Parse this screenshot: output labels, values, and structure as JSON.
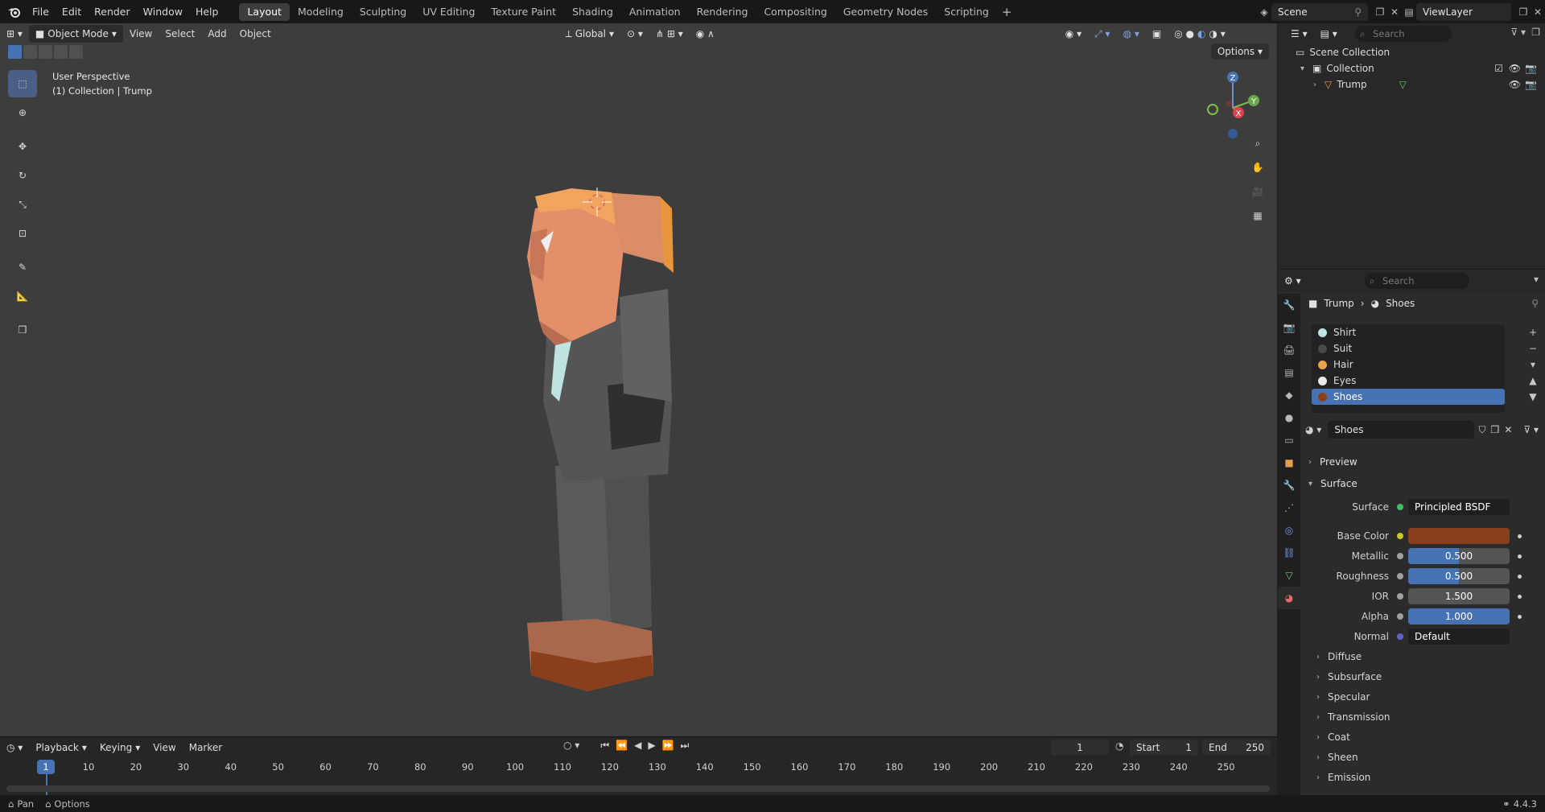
{
  "topbar": {
    "menus": [
      "File",
      "Edit",
      "Render",
      "Window",
      "Help"
    ],
    "workspaces": [
      "Layout",
      "Modeling",
      "Sculpting",
      "UV Editing",
      "Texture Paint",
      "Shading",
      "Animation",
      "Rendering",
      "Compositing",
      "Geometry Nodes",
      "Scripting"
    ],
    "active_workspace": "Layout",
    "scene": "Scene",
    "view_layer": "ViewLayer"
  },
  "viewport": {
    "mode": "Object Mode",
    "menus": [
      "View",
      "Select",
      "Add",
      "Object"
    ],
    "orientation": "Global",
    "options_label": "Options",
    "info_line1": "User Perspective",
    "info_line2": "(1) Collection | Trump",
    "gizmo": {
      "z": "Z",
      "x": "X",
      "y": "Y"
    }
  },
  "timeline": {
    "menus": [
      "Playback",
      "Keying",
      "View",
      "Marker"
    ],
    "current_frame": "1",
    "start_label": "Start",
    "start": "1",
    "end_label": "End",
    "end": "250",
    "ticks": [
      "10",
      "20",
      "30",
      "40",
      "50",
      "60",
      "70",
      "80",
      "90",
      "100",
      "110",
      "120",
      "130",
      "140",
      "150",
      "160",
      "170",
      "180",
      "190",
      "200",
      "210",
      "220",
      "230",
      "240",
      "250"
    ],
    "playhead": "1"
  },
  "statusbar": {
    "pan": "Pan",
    "options": "Options",
    "version": "4.4.3"
  },
  "outliner": {
    "search_placeholder": "Search",
    "scene_collection": "Scene Collection",
    "collection": "Collection",
    "object": "Trump"
  },
  "properties": {
    "search_placeholder": "Search",
    "object": "Trump",
    "material": "Shoes",
    "slots": [
      {
        "name": "Shirt",
        "color": "#bfe3e0"
      },
      {
        "name": "Suit",
        "color": "#4a4a4a"
      },
      {
        "name": "Hair",
        "color": "#e9a34a"
      },
      {
        "name": "Eyes",
        "color": "#e8e8e8"
      },
      {
        "name": "Shoes",
        "color": "#8a3f1c"
      }
    ],
    "active_slot": 4,
    "preview": "Preview",
    "surface_panel": "Surface",
    "surface_label": "Surface",
    "surface_value": "Principled BSDF",
    "base_color_label": "Base Color",
    "base_color": "#8a3f1c",
    "metallic_label": "Metallic",
    "metallic": "0.500",
    "roughness_label": "Roughness",
    "roughness": "0.500",
    "ior_label": "IOR",
    "ior": "1.500",
    "alpha_label": "Alpha",
    "alpha": "1.000",
    "normal_label": "Normal",
    "normal_value": "Default",
    "subpanels": [
      "Diffuse",
      "Subsurface",
      "Specular",
      "Transmission",
      "Coat",
      "Sheen",
      "Emission"
    ]
  }
}
